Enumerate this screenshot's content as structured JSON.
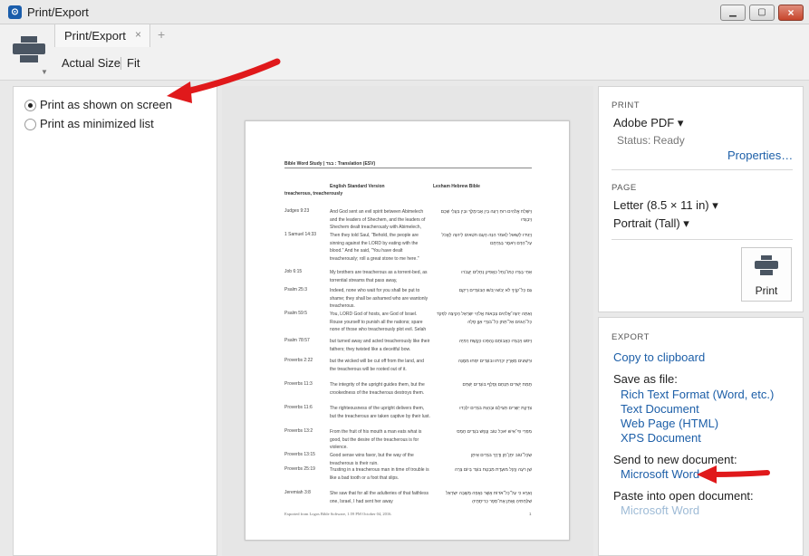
{
  "window": {
    "title": "Print/Export",
    "app_icon": "logos-icon",
    "buttons": [
      "minimize",
      "maximize",
      "close"
    ]
  },
  "toolbar": {
    "tab_label": "Print/Export",
    "tab_close": "×",
    "tab_add": "+",
    "actual_size": "Actual Size",
    "fit": "Fit"
  },
  "options": {
    "print_as_shown": "Print as shown on screen",
    "print_as_minimized": "Print as minimized list",
    "selected": "print_as_shown"
  },
  "doc": {
    "title": "Bible Word Study | בגד : Translation (ESV)",
    "col_esv": "English Standard Version",
    "col_lhb": "Lexham Hebrew Bible",
    "term": "treacherous, treacherously",
    "footer": "Exported from Logos Bible Software, 1:59 PM October 04, 2016.",
    "page_number": "1",
    "rows": [
      {
        "ref": "Judges 9:23",
        "text": "And God sent an evil spirit between Abimelech and the leaders of Shechem, and the leaders of Shechem dealt treacherously with Abimelech,",
        "heb": "וַיִּשְׁלַח אֱלֹהִים רוּחַ רָעָה בֵּין אֲבִימֶלֶךְ וּבֵין בַּעֲלֵי שְׁכֶם וַיִּבְגְּדוּ"
      },
      {
        "ref": "1 Samuel 14:33",
        "text": "Then they told Saul, \"Behold, the people are sinning against the LORD by eating with the blood.\" And he said, \"You have dealt treacherously; roll a great stone to me here.\"",
        "heb": "וַיַּגִּידוּ לְשָׁאוּל לֵאמֹר הִנֵּה הָעָם חֹטִאים לַיהוָה לֶאֱכֹל עַל־הַדָּם וַיֹּאמֶר בְּגַדְתֶּם"
      },
      {
        "ref": "Job 6:15",
        "text": "My brothers are treacherous as a torrent-bed, as torrential streams that pass away,",
        "heb": "אַחַי בָּגְדוּ כְמוֹ־נָחַל כַּאֲפִיק נְחָלִים יַעֲבֹרוּ"
      },
      {
        "ref": "Psalm 25:3",
        "text": "Indeed, none who wait for you shall be put to shame; they shall be ashamed who are wantonly treacherous.",
        "heb": "גַּם כָּל־קוֶֹיךָ לֹא יֵבֹשׁוּ יֵבֹשׁוּ הַבּוֹגְדִים רֵיקָם"
      },
      {
        "ref": "Psalm 59:5",
        "text": "You, LORD God of hosts, are God of Israel. Rouse yourself to punish all the nations; spare none of those who treacherously plot evil. Selah",
        "heb": "וְאַתָּה יְהוָה־אֱלֹהִים צְבָאוֹת אֱלֹהֵי יִשְׂרָאֵל הָקִיצָה לִפְקֹד כָּל־הַגּוֹיִם אַל־תָּחֹן כָּל־בֹּגְדֵי אָוֶן סֶלָה"
      },
      {
        "ref": "Psalm 78:57",
        "text": "but turned away and acted treacherously like their fathers; they twisted like a deceitful bow.",
        "heb": "וַיִּסֹּגוּ וַיִּבְגְּדוּ כַּאֲבוֹתָם נֶהְפְּכוּ כְּקֶשֶׁת רְמִיָּה"
      },
      {
        "ref": "Proverbs 2:22",
        "text": "but the wicked will be cut off from the land, and the treacherous will be rooted out of it.",
        "heb": "וּרְשָׁעִים מֵאֶרֶץ יִכָּרֵתוּ וּבוֹגְדִים יִסְּחוּ מִמֶּנָּה"
      },
      {
        "ref": "Proverbs 11:3",
        "text": "The integrity of the upright guides them, but the crookedness of the treacherous destroys them.",
        "heb": "תֻּמַּת יְשָׁרִים תַּנְחֵם וְסֶלֶף בּוֹגְדִים יְשָׁדֵּם"
      },
      {
        "ref": "Proverbs 11:6",
        "text": "The righteousness of the upright delivers them, but the treacherous are taken captive by their lust.",
        "heb": "צִדְקַת יְשָׁרִים תַּצִּילֵם וּבְהַוַּת בֹּגְדִים יִלָּכֵדוּ"
      },
      {
        "ref": "Proverbs 13:2",
        "text": "From the fruit of his mouth a man eats what is good, but the desire of the treacherous is for violence.",
        "heb": "מִפְּרִי פִי־אִישׁ יֹאכַל טוֹב וְנֶפֶשׁ בֹּגְדִים חָמָס"
      },
      {
        "ref": "Proverbs 13:15",
        "text": "Good sense wins favor, but the way of the treacherous is their ruin.",
        "heb": "שֵׂכֶל־טוֹב יִתֶּן־חֵן וְדֶרֶךְ בֹּגְדִים אֵיתָן"
      },
      {
        "ref": "Proverbs 25:19",
        "text": "Trusting in a treacherous man in time of trouble is like a bad tooth or a foot that slips.",
        "heb": "שֵׁן רֹעָה וְרֶגֶל מוּעָדֶת מִבְטָח בּוֹגֵד בְּיוֹם צָרָה"
      },
      {
        "ref": "Jeremiah 3:8",
        "text": "She saw that for all the adulteries of that faithless one, Israel, I had sent her away",
        "heb": "וָאֵרֶא כִּי עַל־כָּל־אֹדוֹת אֲשֶׁר נִאֲפָה מְשֻׁבָה יִשְׂרָאֵל שִׁלַּחְתִּיהָ וָאֶתֵּן אֶת־סֵפֶר כְּרִיתֻתֶיהָ"
      }
    ]
  },
  "print": {
    "section": "PRINT",
    "printer": "Adobe PDF",
    "status_label": "Status:",
    "status_value": "Ready",
    "properties": "Properties…",
    "page_section": "PAGE",
    "paper": "Letter (8.5 × 11 in)",
    "orientation": "Portrait (Tall)",
    "print_button": "Print"
  },
  "export": {
    "section": "EXPORT",
    "copy": "Copy to clipboard",
    "save_as": "Save as file:",
    "rtf": "Rich Text Format (Word, etc.)",
    "text": "Text Document",
    "html": "Web Page (HTML)",
    "xps": "XPS Document",
    "send_new": "Send to new document:",
    "word_new": "Microsoft Word",
    "paste_open": "Paste into open document:",
    "word_open": "Microsoft Word"
  },
  "colors": {
    "accent_link": "#1d5fa8",
    "arrow_red": "#e0191b",
    "disabled_link": "#9ebbd6"
  }
}
